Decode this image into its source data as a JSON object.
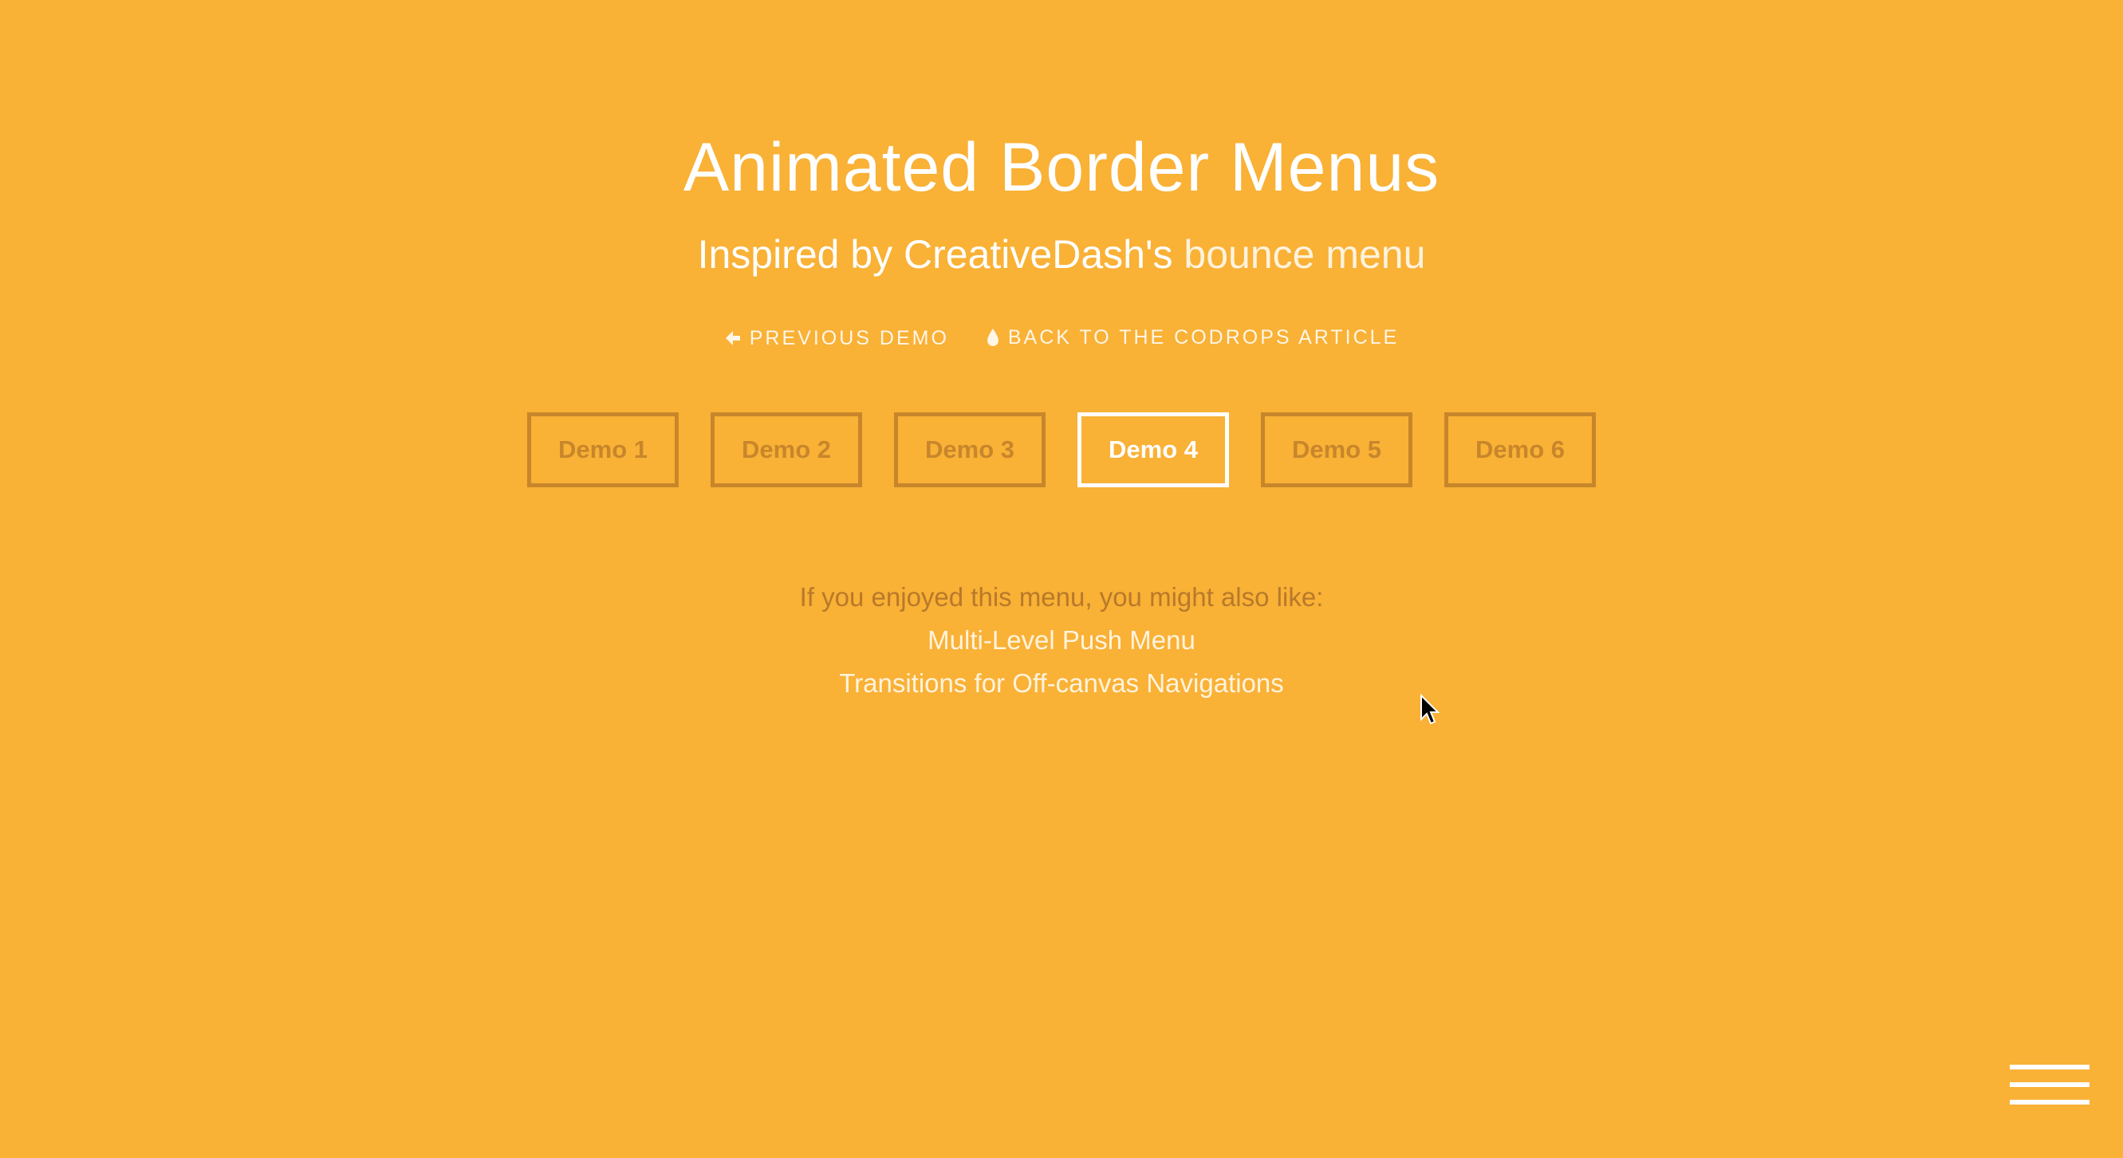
{
  "header": {
    "title": "Animated Border Menus",
    "subtitle_prefix": "Inspired by CreativeDash's",
    "subtitle_link": "bounce menu"
  },
  "top_links": {
    "previous_demo": "PREVIOUS DEMO",
    "back_to_article": "BACK TO THE CODROPS ARTICLE"
  },
  "demos": [
    {
      "label": "Demo 1",
      "active": false
    },
    {
      "label": "Demo 2",
      "active": false
    },
    {
      "label": "Demo 3",
      "active": false
    },
    {
      "label": "Demo 4",
      "active": true
    },
    {
      "label": "Demo 5",
      "active": false
    },
    {
      "label": "Demo 6",
      "active": false
    }
  ],
  "related": {
    "intro": "If you enjoyed this menu, you might also like:",
    "links": [
      "Multi-Level Push Menu",
      "Transitions for Off-canvas Navigations"
    ]
  },
  "icons": {
    "previous": "arrow-left-icon",
    "article": "drop-icon",
    "menu": "hamburger-icon"
  },
  "colors": {
    "background": "#f9b136",
    "inactive_button": "#c8862b",
    "active_button": "#ffffff"
  }
}
